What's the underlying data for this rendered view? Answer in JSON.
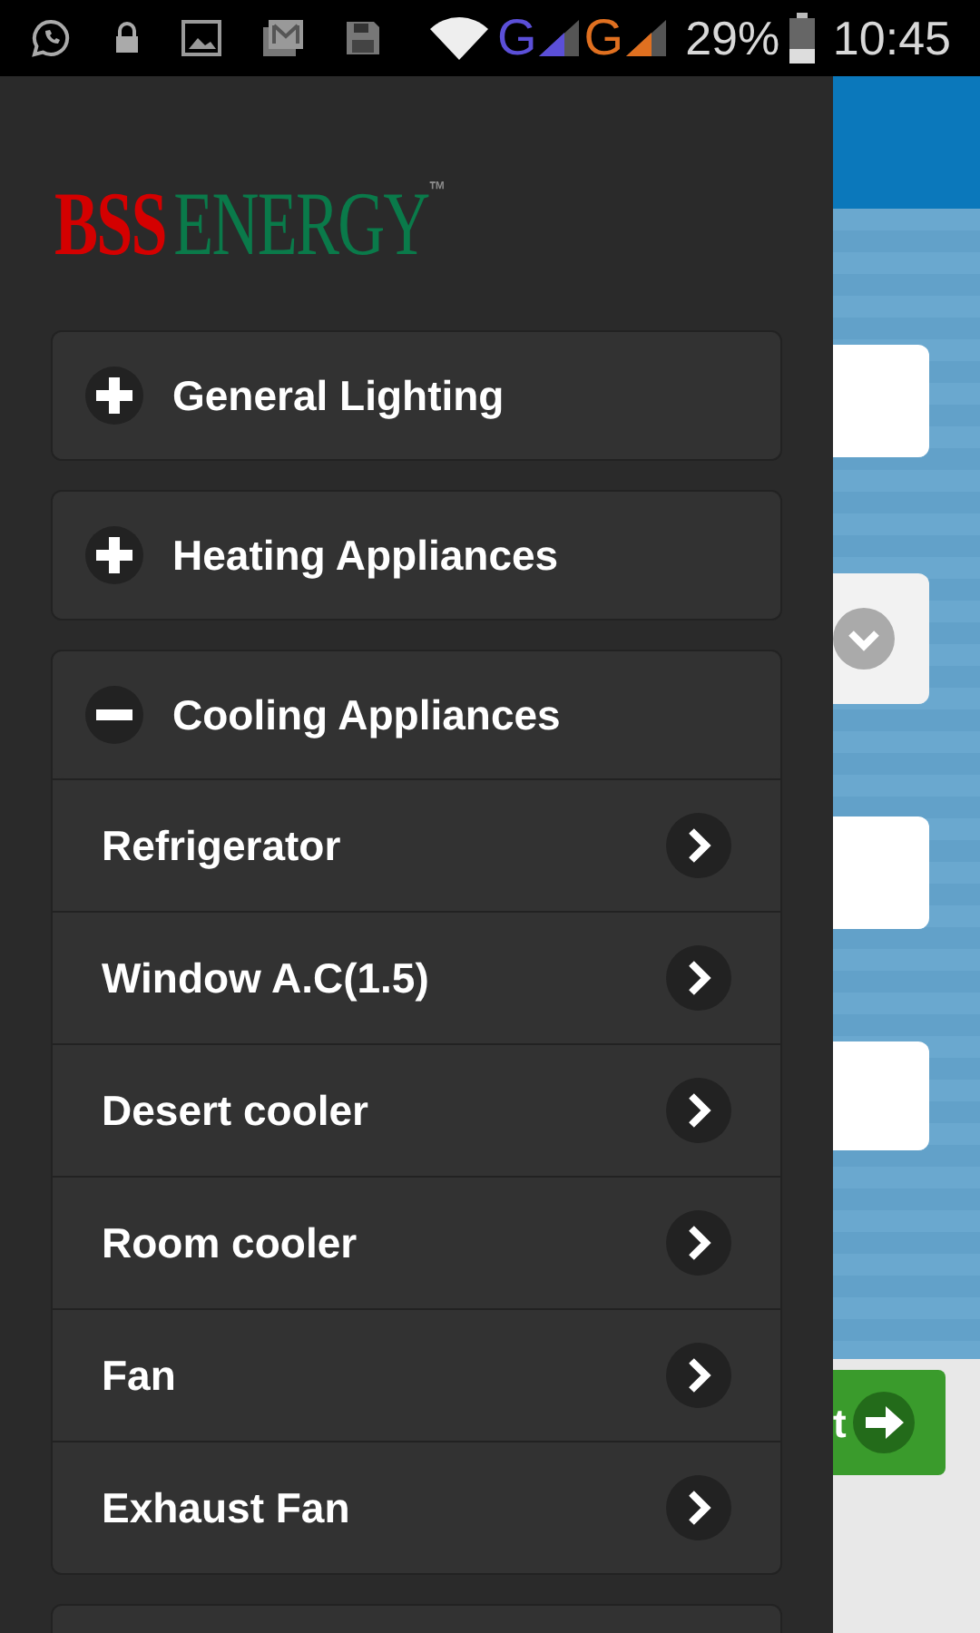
{
  "status_bar": {
    "networks": [
      {
        "label": "G",
        "color": "#5b4fd8"
      },
      {
        "label": "G",
        "color": "#e07020"
      }
    ],
    "battery": "29%",
    "time": "10:45"
  },
  "logo": {
    "primary": "BSS",
    "secondary": "ENERGY",
    "mark": "™"
  },
  "menu": [
    {
      "label": "General Lighting",
      "expanded": false
    },
    {
      "label": "Heating Appliances",
      "expanded": false
    },
    {
      "label": "Cooling Appliances",
      "expanded": true,
      "items": [
        {
          "label": "Refrigerator"
        },
        {
          "label": "Window A.C(1.5)"
        },
        {
          "label": "Desert cooler"
        },
        {
          "label": "Room cooler"
        },
        {
          "label": "Fan"
        },
        {
          "label": "Exhaust Fan"
        }
      ]
    }
  ],
  "background_form": {
    "fields": [
      {
        "kind": "text"
      },
      {
        "kind": "select"
      },
      {
        "kind": "text"
      },
      {
        "kind": "text"
      }
    ],
    "next_button": {
      "label": "t"
    }
  }
}
